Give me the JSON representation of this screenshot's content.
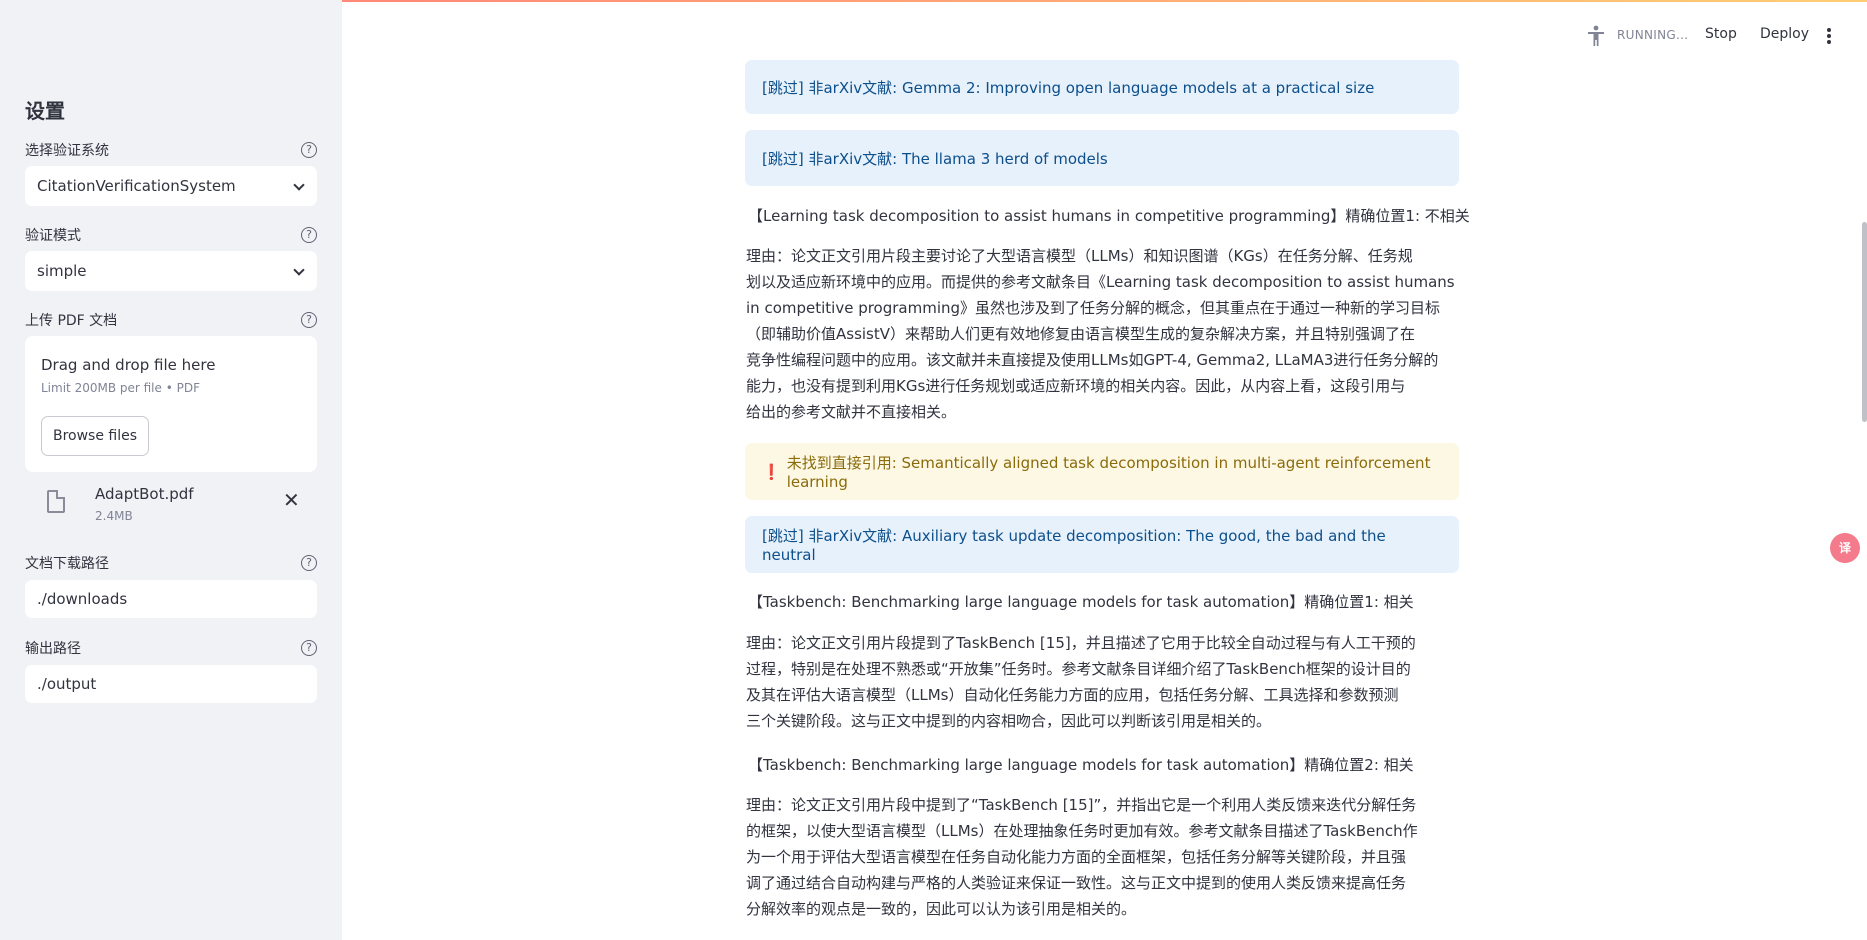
{
  "header": {
    "running_label": "RUNNING...",
    "stop_label": "Stop",
    "deploy_label": "Deploy",
    "running_icon": "accessibility-figure-icon",
    "menu_icon": "kebab-menu-icon"
  },
  "sidebar": {
    "title": "设置",
    "system": {
      "label": "选择验证系统",
      "value": "CitationVerificationSystem"
    },
    "mode": {
      "label": "验证模式",
      "value": "simple"
    },
    "upload": {
      "label": "上传 PDF 文档",
      "drop_title": "Drag and drop file here",
      "drop_limit": "Limit 200MB per file • PDF",
      "browse_label": "Browse files",
      "file_name": "AdaptBot.pdf",
      "file_size": "2.4MB"
    },
    "download_path": {
      "label": "文档下载路径",
      "value": "./downloads"
    },
    "output_path": {
      "label": "输出路径",
      "value": "./output"
    },
    "help_glyph": "?"
  },
  "main": {
    "alert1": "[跳过] 非arXiv文献: Gemma 2: Improving open language models at a practical size",
    "alert2": "[跳过] 非arXiv文献: The llama 3 herd of models",
    "heading1": "【Learning task decomposition to assist humans in competitive programming】精确位置1: 不相关",
    "reason1": [
      "理由：论文正文引用片段主要讨论了大型语言模型（LLMs）和知识图谱（KGs）在任务分解、任务规",
      "划以及适应新环境中的应用。而提供的参考文献条目《Learning task decomposition to assist humans",
      "in competitive programming》虽然也涉及到了任务分解的概念，但其重点在于通过一种新的学习目标",
      "（即辅助价值AssistV）来帮助人们更有效地修复由语言模型生成的复杂解决方案，并且特别强调了在",
      "竞争性编程问题中的应用。该文献并未直接提及使用LLMs如GPT-4, Gemma2, LLaMA3进行任务分解的",
      "能力，也没有提到利用KGs进行任务规划或适应新环境的相关内容。因此，从内容上看，这段引用与",
      "给出的参考文献并不直接相关。"
    ],
    "warn_mark": "❗",
    "warn1": "未找到直接引用: Semantically aligned task decomposition in multi-agent reinforcement learning",
    "alert3": "[跳过] 非arXiv文献: Auxiliary task update decomposition: The good, the bad and the neutral",
    "heading2": "【Taskbench: Benchmarking large language models for task automation】精确位置1: 相关",
    "reason2": [
      "理由：论文正文引用片段提到了TaskBench [15]，并且描述了它用于比较全自动过程与有人工干预的",
      "过程，特别是在处理不熟悉或“开放集”任务时。参考文献条目详细介绍了TaskBench框架的设计目的",
      "及其在评估大语言模型（LLMs）自动化任务能力方面的应用，包括任务分解、工具选择和参数预测",
      "三个关键阶段。这与正文中提到的内容相吻合，因此可以判断该引用是相关的。"
    ],
    "heading3": "【Taskbench: Benchmarking large language models for task automation】精确位置2: 相关",
    "reason3": [
      "理由：论文正文引用片段中提到了“TaskBench [15]”，并指出它是一个利用人类反馈来迭代分解任务",
      "的框架，以使大型语言模型（LLMs）在处理抽象任务时更加有效。参考文献条目描述了TaskBench作",
      "为一个用于评估大型语言模型在任务自动化能力方面的全面框架，包括任务分解等关键阶段，并且强",
      "调了通过结合自动构建与严格的人类验证来保证一致性。这与正文中提到的使用人类反馈来提高任务",
      "分解效率的观点是一致的，因此可以认为该引用是相关的。"
    ]
  },
  "float_badge": "译"
}
